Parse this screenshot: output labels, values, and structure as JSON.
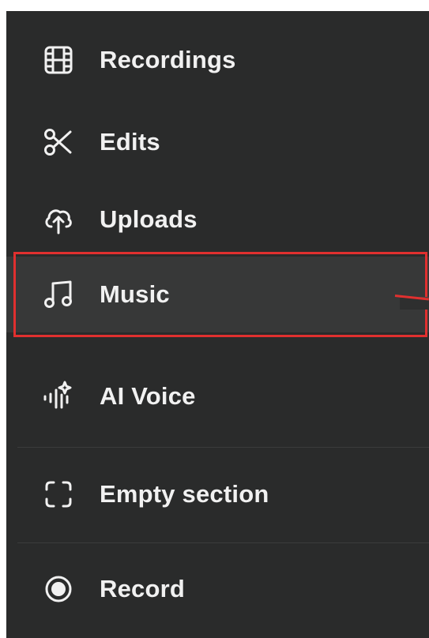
{
  "sidebar": {
    "items": [
      {
        "label": "Recordings",
        "icon": "film-icon"
      },
      {
        "label": "Edits",
        "icon": "scissors-icon"
      },
      {
        "label": "Uploads",
        "icon": "cloud-upload-icon"
      },
      {
        "label": "Music",
        "icon": "music-note-icon",
        "selected": true
      },
      {
        "label": "AI Voice",
        "icon": "ai-voice-icon"
      },
      {
        "label": "Empty section",
        "icon": "dashed-frame-icon"
      },
      {
        "label": "Record",
        "icon": "record-icon"
      }
    ]
  },
  "colors": {
    "sidebar_background": "#2a2b2b",
    "selected_background": "#373838",
    "text": "#f1f1f1",
    "highlight": "#e0302f"
  }
}
